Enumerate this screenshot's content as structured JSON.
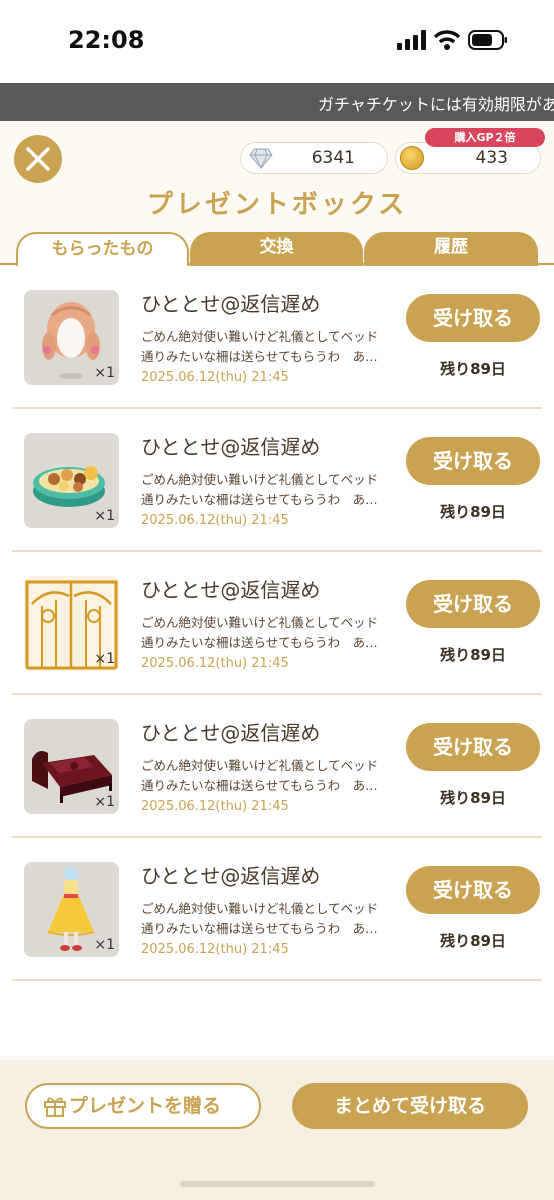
{
  "status_bar": {
    "time": "22:08"
  },
  "ticker": {
    "text": "ガチャチケットには有効期限があります"
  },
  "currency": {
    "gems": "6341",
    "coins": "433",
    "promo_badge": "購入GP２倍"
  },
  "title": "プレゼントボックス",
  "tabs": [
    {
      "label": "もらったもの",
      "active": true
    },
    {
      "label": "交換",
      "active": false
    },
    {
      "label": "履歴",
      "active": false
    }
  ],
  "gifts": [
    {
      "sender": "ひととせ@返信遅め",
      "message_line1": "ごめん絶対使い難いけど礼儀としてベッド",
      "message_line2": "通りみたいな柵は送らせてもらうわ　あ…",
      "date": "2025.06.12(thu) 21:45",
      "quantity": "×1",
      "receive_label": "受け取る",
      "remaining": "残り89日",
      "item_icon": "hair-icon"
    },
    {
      "sender": "ひととせ@返信遅め",
      "message_line1": "ごめん絶対使い難いけど礼儀としてベッド",
      "message_line2": "通りみたいな柵は送らせてもらうわ　あ…",
      "date": "2025.06.12(thu) 21:45",
      "quantity": "×1",
      "receive_label": "受け取る",
      "remaining": "残り89日",
      "item_icon": "cookie-tin-icon"
    },
    {
      "sender": "ひととせ@返信遅め",
      "message_line1": "ごめん絶対使い難いけど礼儀としてベッド",
      "message_line2": "通りみたいな柵は送らせてもらうわ　あ…",
      "date": "2025.06.12(thu) 21:45",
      "quantity": "×1",
      "receive_label": "受け取る",
      "remaining": "残り89日",
      "item_icon": "gate-icon"
    },
    {
      "sender": "ひととせ@返信遅め",
      "message_line1": "ごめん絶対使い難いけど礼儀としてベッド",
      "message_line2": "通りみたいな柵は送らせてもらうわ　あ…",
      "date": "2025.06.12(thu) 21:45",
      "quantity": "×1",
      "receive_label": "受け取る",
      "remaining": "残り89日",
      "item_icon": "bed-icon"
    },
    {
      "sender": "ひととせ@返信遅め",
      "message_line1": "ごめん絶対使い難いけど礼儀としてベッド",
      "message_line2": "通りみたいな柵は送らせてもらうわ　あ…",
      "date": "2025.06.12(thu) 21:45",
      "quantity": "×1",
      "receive_label": "受け取る",
      "remaining": "残り89日",
      "item_icon": "yellow-dress-icon"
    }
  ],
  "footer": {
    "send_gift_label": "プレゼントを贈る",
    "receive_all_label": "まとめて受け取る"
  },
  "colors": {
    "accent": "#c9a351",
    "badge": "#d9455c"
  }
}
